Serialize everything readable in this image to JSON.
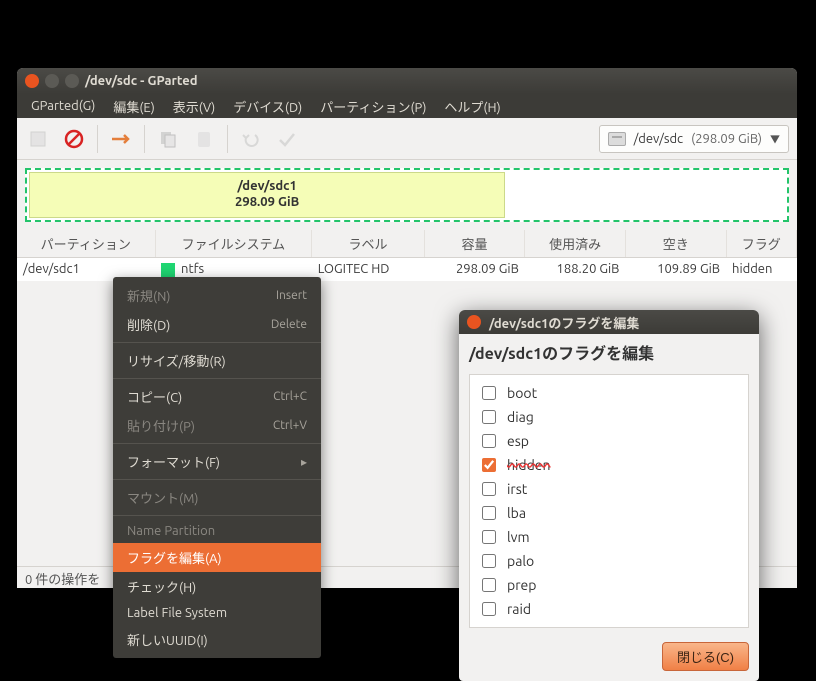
{
  "window": {
    "title": "/dev/sdc - GParted"
  },
  "menubar": {
    "items": [
      "GParted(G)",
      "編集(E)",
      "表示(V)",
      "デバイス(D)",
      "パーティション(P)",
      "ヘルプ(H)"
    ]
  },
  "device_picker": {
    "device": "/dev/sdc",
    "size": "(298.09 GiB)"
  },
  "partition_view": {
    "name": "/dev/sdc1",
    "size": "298.09 GiB"
  },
  "table": {
    "headers": [
      "パーティション",
      "ファイルシステム",
      "ラベル",
      "容量",
      "使用済み",
      "空き",
      "フラグ"
    ],
    "row": {
      "partition": "/dev/sdc1",
      "fs": "ntfs",
      "label": "LOGITEC HD",
      "size": "298.09 GiB",
      "used": "188.20 GiB",
      "free": "109.89 GiB",
      "flags": "hidden"
    }
  },
  "statusbar": {
    "text": "0 件の操作を"
  },
  "context_menu": {
    "items": [
      {
        "label": "新規(N)",
        "accel": "Insert",
        "disabled": true
      },
      {
        "label": "削除(D)",
        "accel": "Delete"
      },
      {
        "sep": true
      },
      {
        "label": "リサイズ/移動(R)"
      },
      {
        "sep": true
      },
      {
        "label": "コピー(C)",
        "accel": "Ctrl+C"
      },
      {
        "label": "貼り付け(P)",
        "accel": "Ctrl+V",
        "disabled": true
      },
      {
        "sep": true
      },
      {
        "label": "フォーマット(F)",
        "submenu": true
      },
      {
        "sep": true
      },
      {
        "label": "マウント(M)",
        "disabled": true
      },
      {
        "sep": true
      },
      {
        "label": "Name Partition",
        "disabled": true
      },
      {
        "label": "フラグを編集(A)",
        "highlight": true
      },
      {
        "label": "チェック(H)"
      },
      {
        "label": "Label File System"
      },
      {
        "label": "新しいUUID(I)"
      }
    ]
  },
  "dialog": {
    "titlebar": "/dev/sdc1のフラグを編集",
    "heading": "/dev/sdc1のフラグを編集",
    "flags": [
      {
        "name": "boot",
        "checked": false
      },
      {
        "name": "diag",
        "checked": false
      },
      {
        "name": "esp",
        "checked": false
      },
      {
        "name": "hidden",
        "checked": true,
        "marked": true
      },
      {
        "name": "irst",
        "checked": false
      },
      {
        "name": "lba",
        "checked": false
      },
      {
        "name": "lvm",
        "checked": false
      },
      {
        "name": "palo",
        "checked": false
      },
      {
        "name": "prep",
        "checked": false
      },
      {
        "name": "raid",
        "checked": false
      }
    ],
    "close_label": "閉じる(C)"
  }
}
